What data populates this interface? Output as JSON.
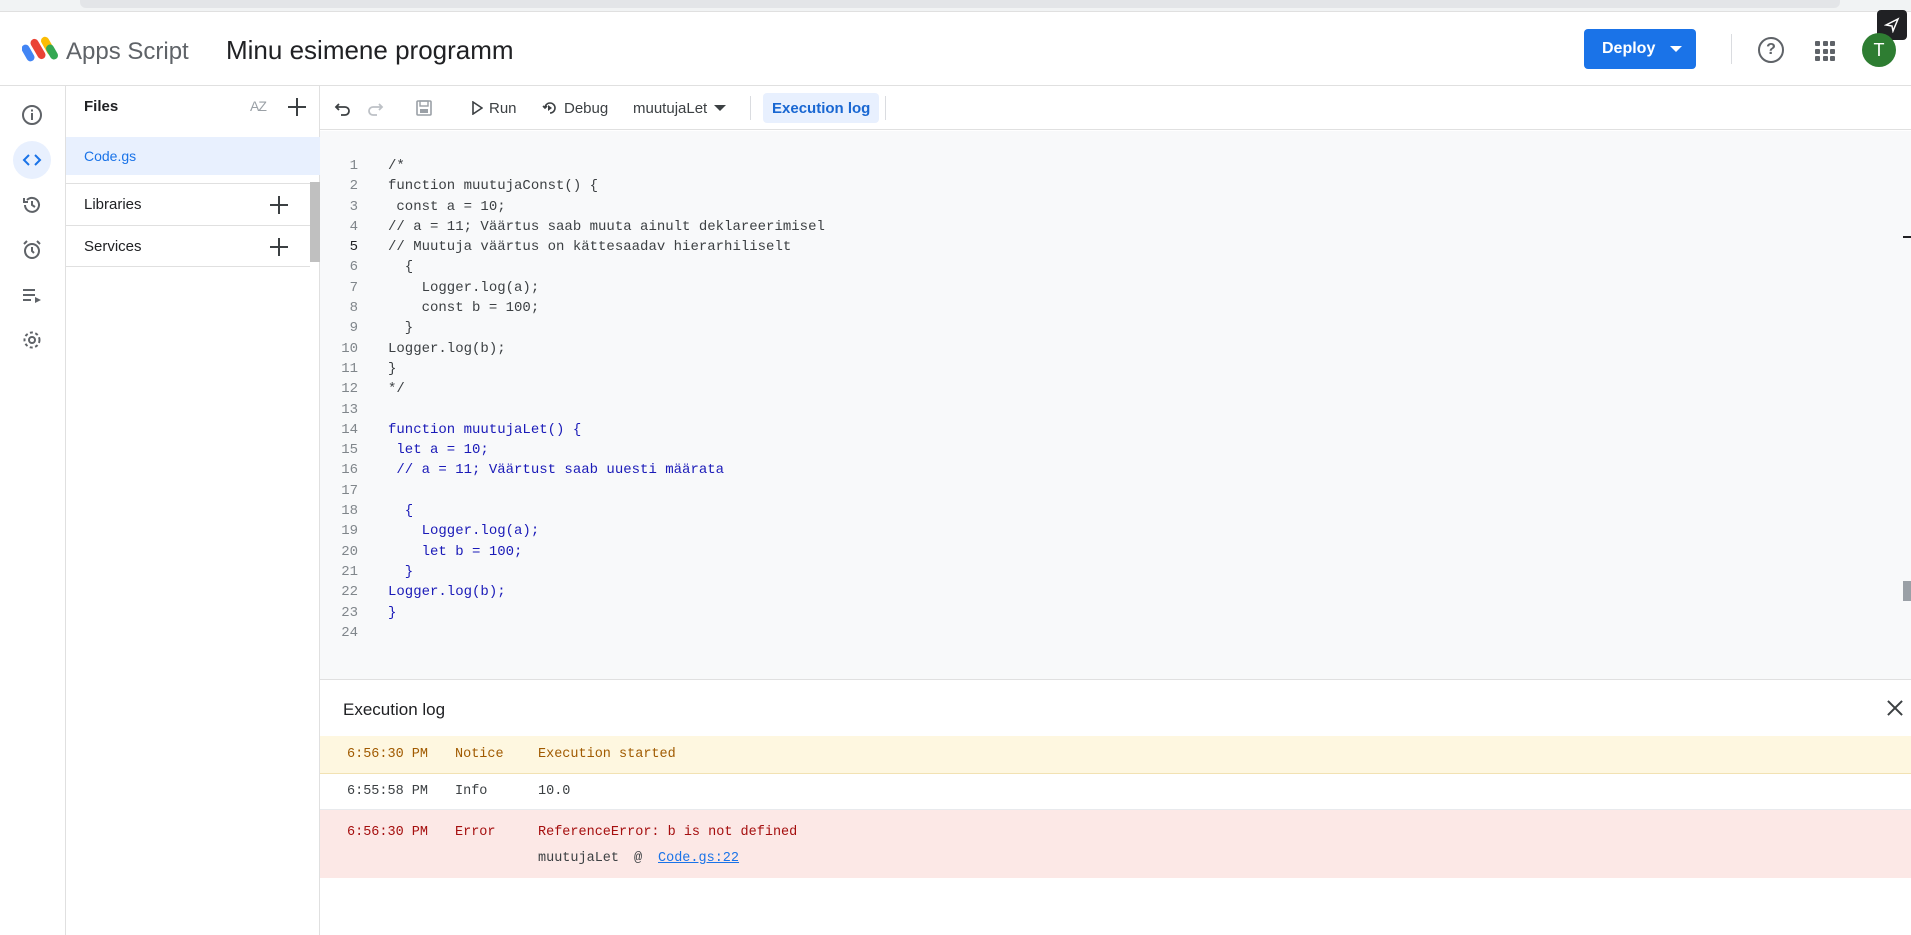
{
  "header": {
    "brand": "Apps Script",
    "project_title": "Minu esimene programm",
    "deploy_label": "Deploy",
    "help_glyph": "?",
    "avatar_initial": "T"
  },
  "rail": {
    "icons": [
      "info-icon",
      "code-icon",
      "history-icon",
      "alarm-icon",
      "executions-icon",
      "settings-icon"
    ],
    "active": "code-icon"
  },
  "files": {
    "title": "Files",
    "sort_label": "AZ",
    "items": [
      "Code.gs"
    ],
    "libraries_label": "Libraries",
    "services_label": "Services"
  },
  "toolbar": {
    "run_label": "Run",
    "debug_label": "Debug",
    "function_select": "muutujaLet",
    "execution_log_label": "Execution log"
  },
  "editor": {
    "current_line": 5,
    "lines": [
      "/*",
      "function muutujaConst() {",
      " const a = 10;",
      "// a = 11; Väärtus saab muuta ainult deklareerimisel",
      "// Muutuja väärtus on kättesaadav hierarhiliselt",
      "  {",
      "    Logger.log(a);",
      "    const b = 100;",
      "  }",
      "Logger.log(b);",
      "}",
      "*/",
      "",
      "function muutujaLet() {",
      " let a = 10;",
      " // a = 11; Väärtust saab uuesti määrata",
      "",
      "  {",
      "    Logger.log(a);",
      "    let b = 100;",
      "  }",
      "Logger.log(b);",
      "}",
      ""
    ]
  },
  "execution_log": {
    "title": "Execution log",
    "rows": [
      {
        "time": "6:56:30 PM",
        "level": "Notice",
        "message": "Execution started"
      },
      {
        "time": "6:55:58 PM",
        "level": "Info",
        "message": "10.0"
      },
      {
        "time": "6:56:30 PM",
        "level": "Error",
        "message": "ReferenceError: b is not defined",
        "trace_fn": "muutujaLet",
        "trace_at": "@",
        "trace_link": "Code.gs:22"
      }
    ]
  },
  "colors": {
    "accent": "#1a73e8",
    "notice_bg": "#fef7e0",
    "error_bg": "#fce8e6"
  }
}
